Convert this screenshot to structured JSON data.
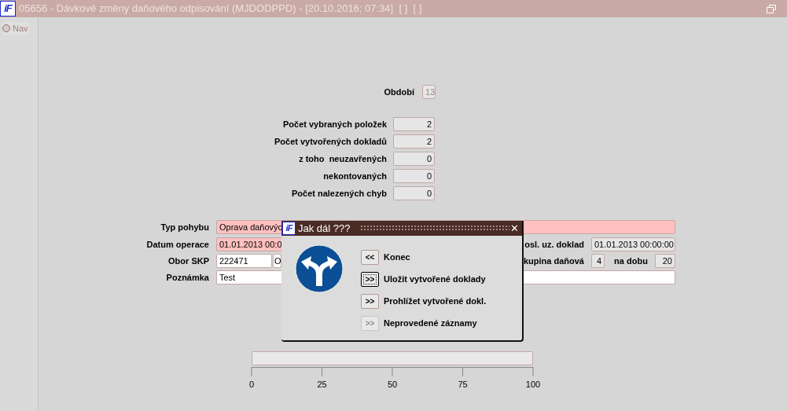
{
  "window": {
    "logo": "iF",
    "title": "05656 - Dávkové změny daňového odpisování (MJDODPPD) - [20.10.2016; 07:34]  [ ]  [ ]"
  },
  "sidebar": {
    "items": [
      {
        "label": "Nav",
        "selected": false
      }
    ]
  },
  "period": {
    "label": "Období",
    "value": "13"
  },
  "stats": [
    {
      "label": "Počet vybraných položek",
      "value": "2"
    },
    {
      "label": "Počet vytvořených dokladů",
      "value": "2"
    },
    {
      "label": "z toho  neuzavřených",
      "value": "0"
    },
    {
      "label": "nekontovaných",
      "value": "0"
    },
    {
      "label": "Počet nalezených chyb",
      "value": "0"
    }
  ],
  "form": {
    "movement_type": {
      "label": "Typ pohybu",
      "value": "Oprava daňovýc",
      "required": true
    },
    "operation_date": {
      "label": "Datum operace",
      "value": "01.01.2013 00:0",
      "required": true
    },
    "last_document": {
      "label": "osl. uz. doklad",
      "value": "01.01.2013 00:00:00"
    },
    "skp": {
      "label": "Obor SKP",
      "value": "222471",
      "value_2": "O"
    },
    "tax_group": {
      "label": "kupina daňová",
      "value": "4"
    },
    "duration": {
      "label": "na dobu",
      "value": "20"
    },
    "note": {
      "label": "Poznámka",
      "value": "Test"
    }
  },
  "progress": {
    "level": 0,
    "scale": [
      "0",
      "25",
      "50",
      "75",
      "100"
    ]
  },
  "dialog": {
    "logo": "iF",
    "title": "Jak dál ???",
    "close": "✕",
    "options": [
      {
        "button": "<<",
        "label": "Konec",
        "focused": false,
        "disabled": false
      },
      {
        "button": ">>",
        "label": "Uložit vytvořené doklady",
        "focused": true,
        "disabled": false
      },
      {
        "button": ">>",
        "label": "Prohlížet vytvořené dokl.",
        "focused": false,
        "disabled": false
      },
      {
        "button": ">>",
        "label": "Neprovedené záznamy",
        "focused": false,
        "disabled": true
      }
    ]
  }
}
